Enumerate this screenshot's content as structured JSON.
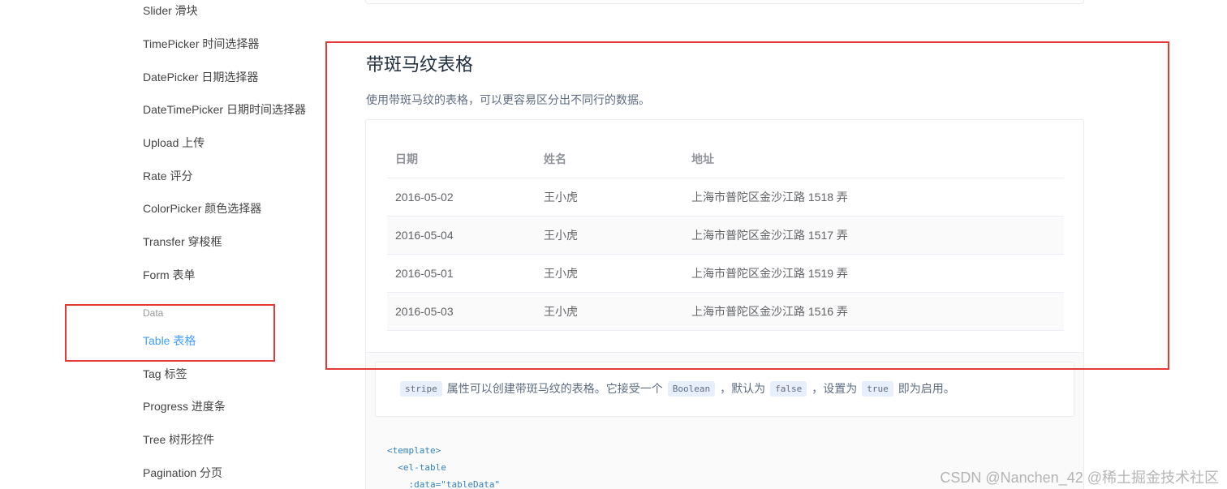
{
  "sidebar": {
    "items": [
      {
        "label": "Slider 滑块"
      },
      {
        "label": "TimePicker 时间选择器"
      },
      {
        "label": "DatePicker 日期选择器"
      },
      {
        "label": "DateTimePicker 日期时间选择器"
      },
      {
        "label": "Upload 上传"
      },
      {
        "label": "Rate 评分"
      },
      {
        "label": "ColorPicker 颜色选择器"
      },
      {
        "label": "Transfer 穿梭框"
      },
      {
        "label": "Form 表单"
      }
    ],
    "group_label": "Data",
    "data_items": [
      {
        "label": "Table 表格",
        "active": true
      },
      {
        "label": "Tag 标签"
      },
      {
        "label": "Progress 进度条"
      },
      {
        "label": "Tree 树形控件"
      },
      {
        "label": "Pagination 分页"
      }
    ]
  },
  "section": {
    "title": "带斑马纹表格",
    "description": "使用带斑马纹的表格，可以更容易区分出不同行的数据。"
  },
  "table": {
    "headers": [
      "日期",
      "姓名",
      "地址"
    ],
    "rows": [
      [
        "2016-05-02",
        "王小虎",
        "上海市普陀区金沙江路 1518 弄"
      ],
      [
        "2016-05-04",
        "王小虎",
        "上海市普陀区金沙江路 1517 弄"
      ],
      [
        "2016-05-01",
        "王小虎",
        "上海市普陀区金沙江路 1519 弄"
      ],
      [
        "2016-05-03",
        "王小虎",
        "上海市普陀区金沙江路 1516 弄"
      ]
    ]
  },
  "meta": {
    "code_stripe": "stripe",
    "text1": "属性可以创建带斑马纹的表格。它接受一个",
    "code_boolean": "Boolean",
    "text2": "，默认为",
    "code_false": "false",
    "text3": "，设置为",
    "code_true": "true",
    "text4": "即为启用。"
  },
  "code_sample": {
    "line1": "<template>",
    "line2": "  <el-table",
    "line3": "    :data=\"tableData\""
  },
  "watermark": "CSDN @Nanchen_42  @稀土掘金技术社区",
  "colors": {
    "accent": "#409eff",
    "highlight": "#e53935",
    "stripe": "#fafafa"
  }
}
